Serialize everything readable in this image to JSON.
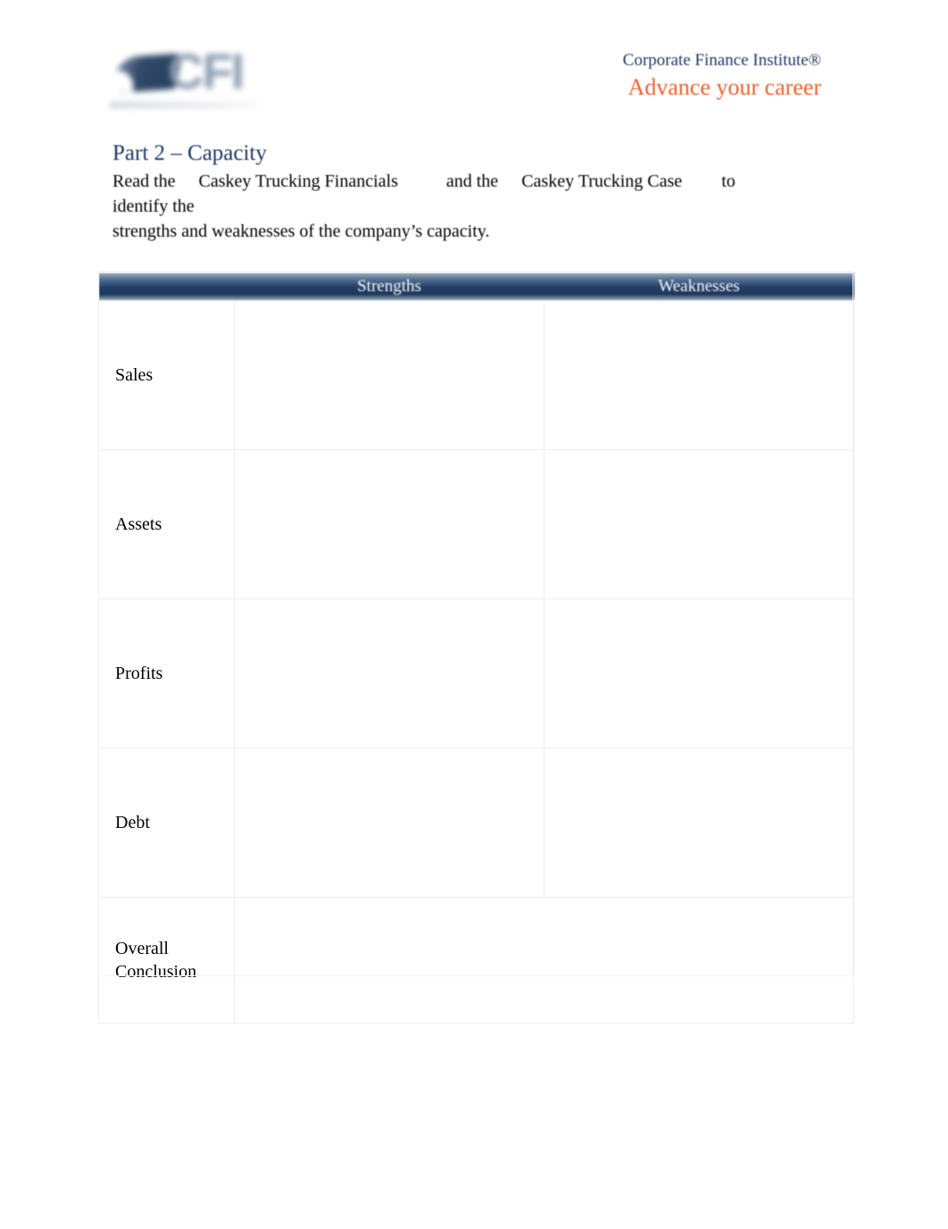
{
  "header": {
    "logo": {
      "icon": "cfi-swoosh-logo",
      "letters": "CFI"
    },
    "brand_name": "Corporate Finance Institute®",
    "tagline": "Advance your career"
  },
  "content": {
    "section_title": "Part 2 – Capacity",
    "intro": {
      "lead": "Read the",
      "doc_one": "Caskey Trucking Financials",
      "connector": "and the",
      "doc_two": "Caskey Trucking Case",
      "trailing": "to identify the",
      "line_two": "strengths and weaknesses of the company’s capacity."
    }
  },
  "table": {
    "columns": [
      "",
      "Strengths",
      "Weaknesses"
    ],
    "rows": [
      {
        "label": "Sales",
        "strengths": "",
        "weaknesses": "",
        "merged": false
      },
      {
        "label": "Assets",
        "strengths": "",
        "weaknesses": "",
        "merged": false
      },
      {
        "label": "Profits",
        "strengths": "",
        "weaknesses": "",
        "merged": false
      },
      {
        "label": "Debt",
        "strengths": "",
        "weaknesses": "",
        "merged": false
      },
      {
        "label": "Overall Conclusion",
        "strengths": "",
        "weaknesses": "",
        "merged": true
      }
    ]
  },
  "colors": {
    "brand_navy": "#1f3864",
    "brand_orange": "#e8622c",
    "header_band_dark": "#22406a",
    "header_band_light": "#a8b8c9",
    "cell_border": "#ededed"
  }
}
